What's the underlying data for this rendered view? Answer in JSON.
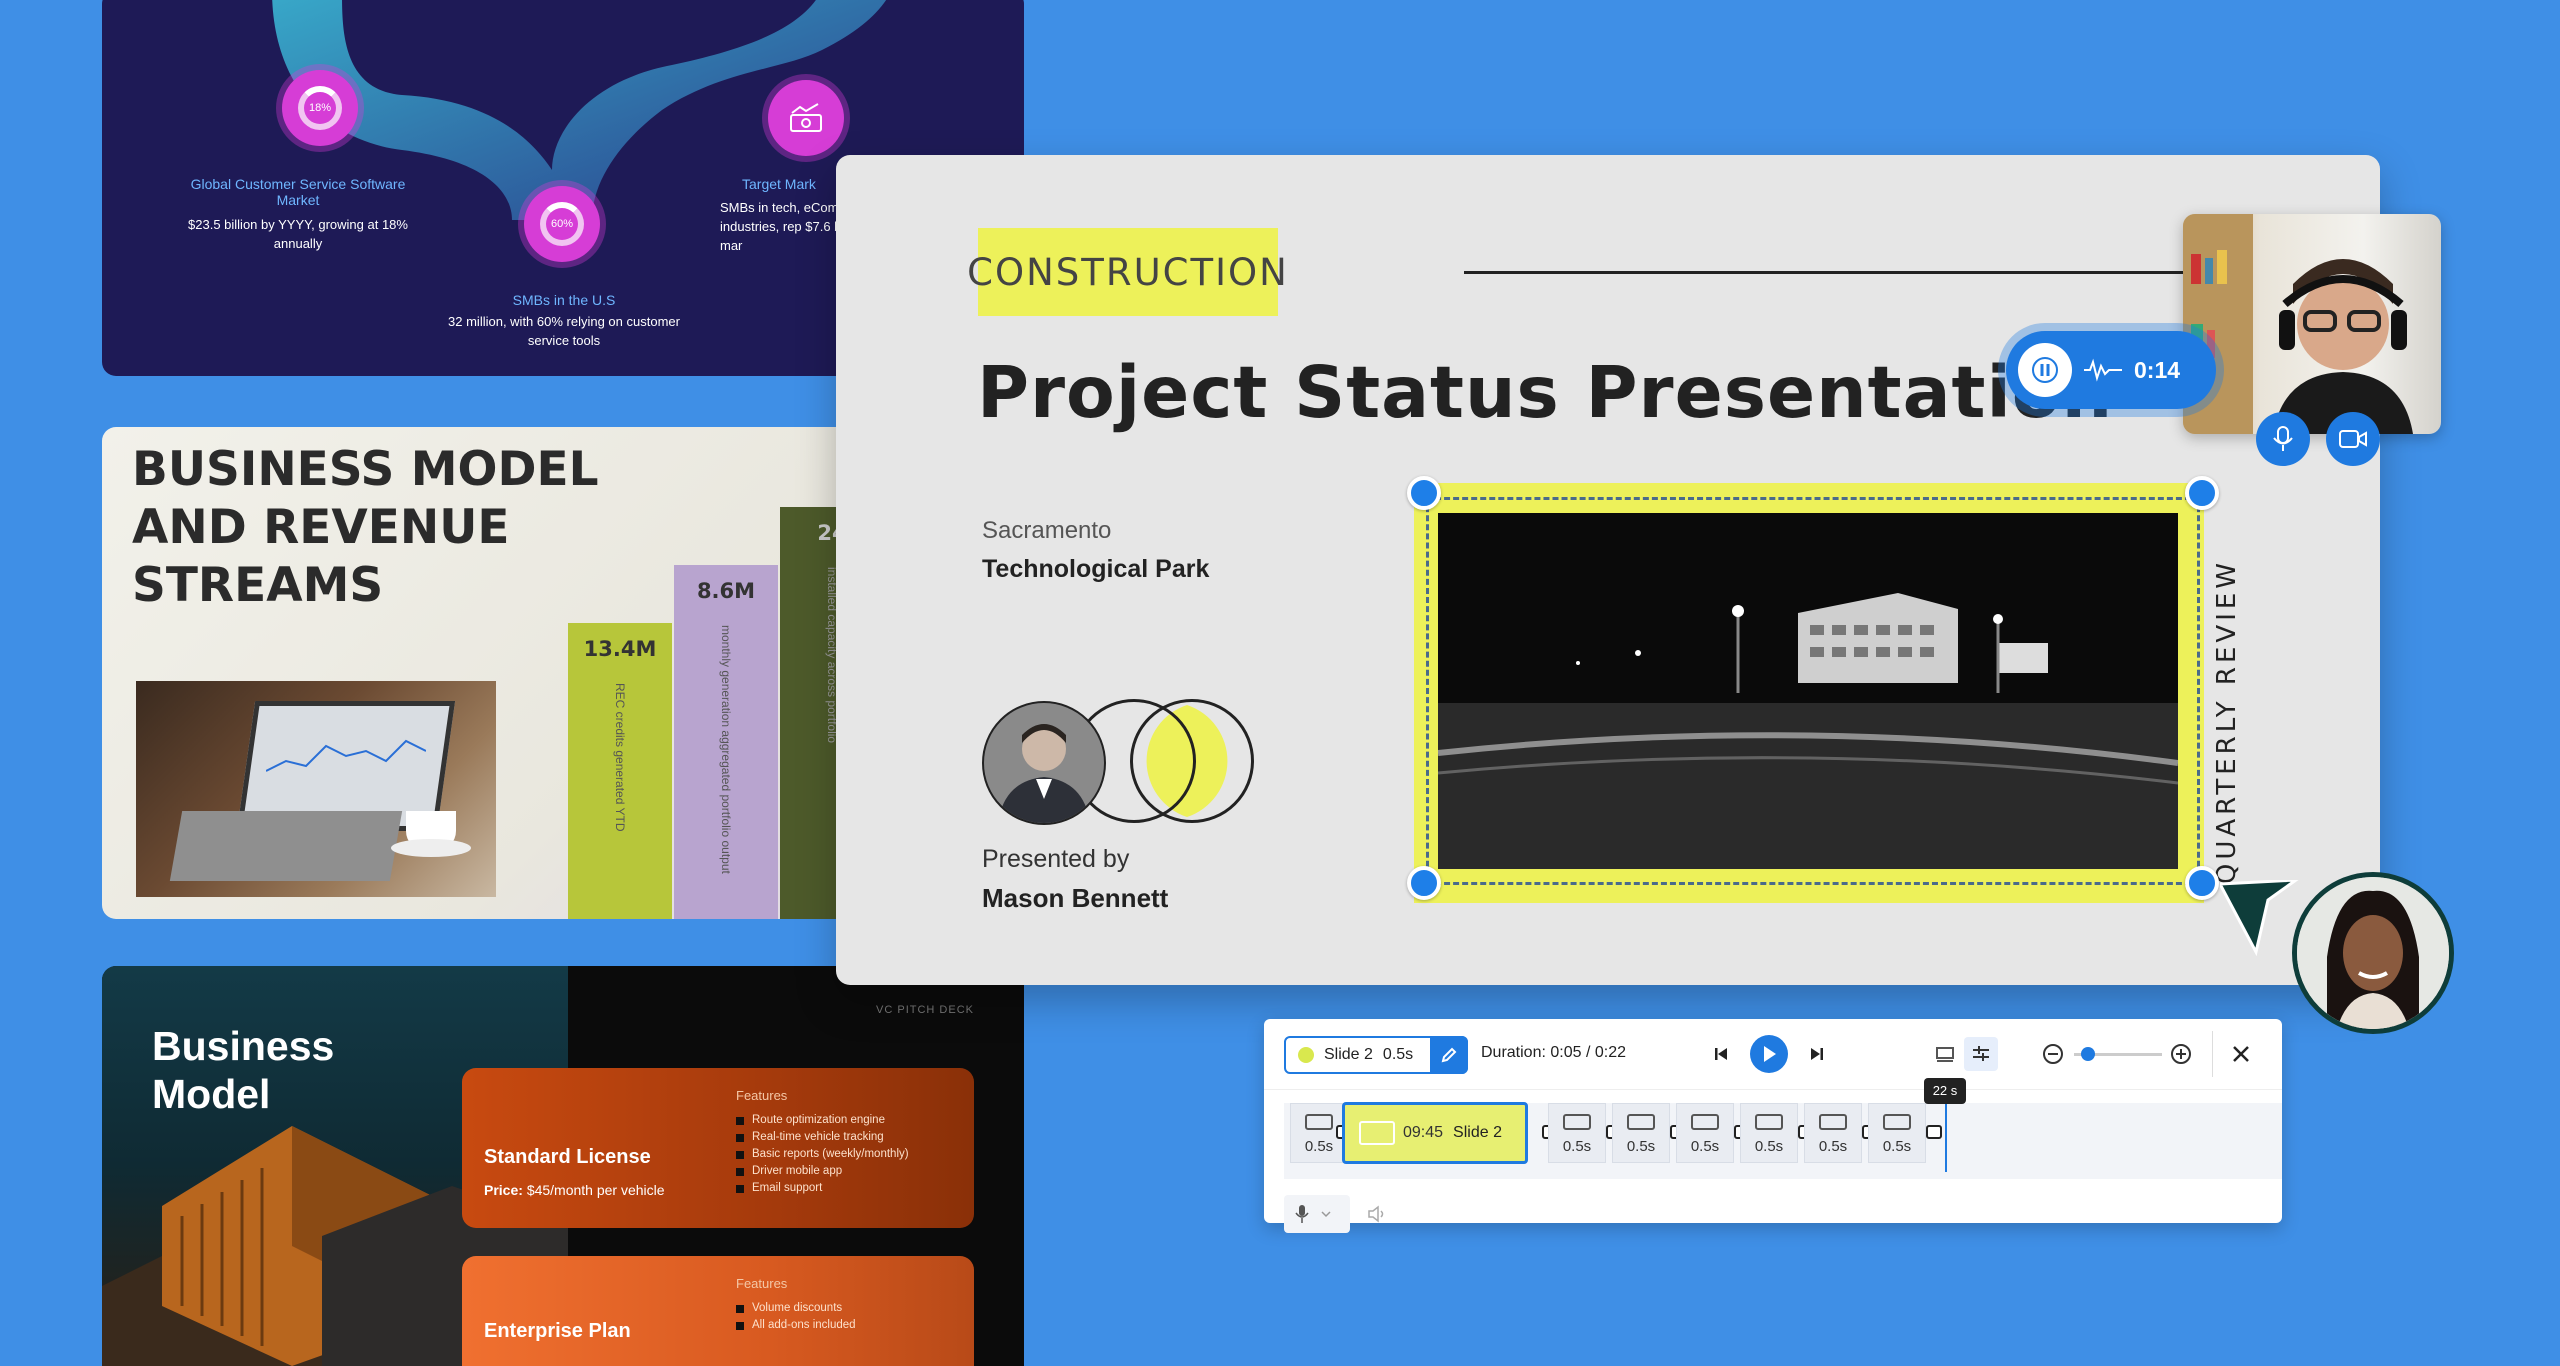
{
  "market_card": {
    "segments": [
      {
        "badge": "18%",
        "title": "Global Customer Service Software Market",
        "text": "$23.5 billion by YYYY, growing at 18% annually"
      },
      {
        "badge": "60%",
        "title": "SMBs in the U.S",
        "text": "32 million, with 60% relying on customer service tools"
      },
      {
        "badge": "",
        "title": "Target Mark",
        "text": "SMBs in tech, eComm SaaS industries, rep $7.6 billion in mar"
      }
    ]
  },
  "revenue_card": {
    "title": "BUSINESS MODEL AND REVENUE STREAMS",
    "bars": [
      {
        "value": "13.4M",
        "desc": "REC credits generated YTD",
        "color": "#b7c63a"
      },
      {
        "value": "8.6M",
        "desc": "monthly generation aggregated portfolio output",
        "color": "#b8a4cf"
      },
      {
        "value": "24",
        "desc": "installed capacity across portfolio",
        "color": "#4d5a2a"
      }
    ]
  },
  "pitch_card": {
    "title_line1": "Business",
    "title_line2": "Model",
    "deck_label": "VC PITCH DECK",
    "plans": [
      {
        "name": "Standard License",
        "price_label": "Price:",
        "price": "$45/month per vehicle",
        "features_heading": "Features",
        "features": [
          "Route optimization engine",
          "Real-time vehicle tracking",
          "Basic reports (weekly/monthly)",
          "Driver mobile app",
          "Email support"
        ]
      },
      {
        "name": "Enterprise Plan",
        "price_label": "",
        "price": "",
        "features_heading": "Features",
        "features": [
          "Volume discounts",
          "All add-ons included"
        ]
      }
    ]
  },
  "main_slide": {
    "tag": "CONSTRUCTION",
    "title": "Project Status Presentation",
    "location_city": "Sacramento",
    "location_place": "Technological Park",
    "presented_by_label": "Presented by",
    "presenter_name": "Mason Bennett",
    "vertical_label": "QUARTERLY REVIEW",
    "accent_color": "#edf15a"
  },
  "recorder": {
    "elapsed": "0:14"
  },
  "editor": {
    "slide_chip_name": "Slide 2",
    "slide_chip_duration": "0.5s",
    "duration_text": "Duration: 0:05 / 0:22",
    "playhead_label": "22 s",
    "active_clip_time": "09:45",
    "active_clip_name": "Slide 2",
    "clip_durations": [
      "0.5s",
      "0.5s",
      "0.5s",
      "0.5s",
      "0.5s",
      "0.5s",
      "0.5s"
    ],
    "first_clip_duration": "0.5s"
  }
}
